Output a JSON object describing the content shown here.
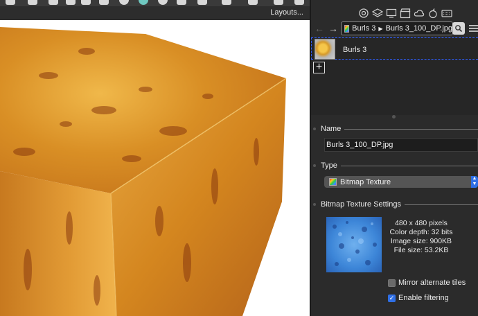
{
  "viewport": {
    "layouts_label": "Layouts..."
  },
  "navigator": {
    "breadcrumb": [
      "Burls 3",
      "Burls 3_100_DP.jpg"
    ],
    "separator": "▶"
  },
  "library": {
    "items": [
      {
        "label": "Burls 3"
      }
    ],
    "add_label": "+"
  },
  "properties": {
    "name_section": "Name",
    "name_value": "Burls 3_100_DP.jpg",
    "type_section": "Type",
    "type_value": "Bitmap Texture",
    "settings_section": "Bitmap Texture Settings",
    "info": {
      "dimensions": "480 x 480 pixels",
      "color_depth": "Color depth: 32 bits",
      "image_size": "Image size: 900KB",
      "file_size": "File size: 53.2KB"
    },
    "options": [
      {
        "label": "Mirror alternate tiles",
        "checked": false
      },
      {
        "label": "Enable filtering",
        "checked": true
      }
    ]
  },
  "colors": {
    "accent": "#2f6fe6",
    "selection_dash": "#2f5fff",
    "panel_bg": "#2b2b2b"
  },
  "icons": [
    "shapes-icon",
    "layers-icon",
    "monitor-icon",
    "clapboard-icon",
    "cloud-icon",
    "apple-icon",
    "keyboard-icon",
    "search-icon",
    "menu-icon",
    "back-arrow-icon",
    "forward-arrow-icon",
    "plus-icon",
    "checkmark-icon"
  ]
}
